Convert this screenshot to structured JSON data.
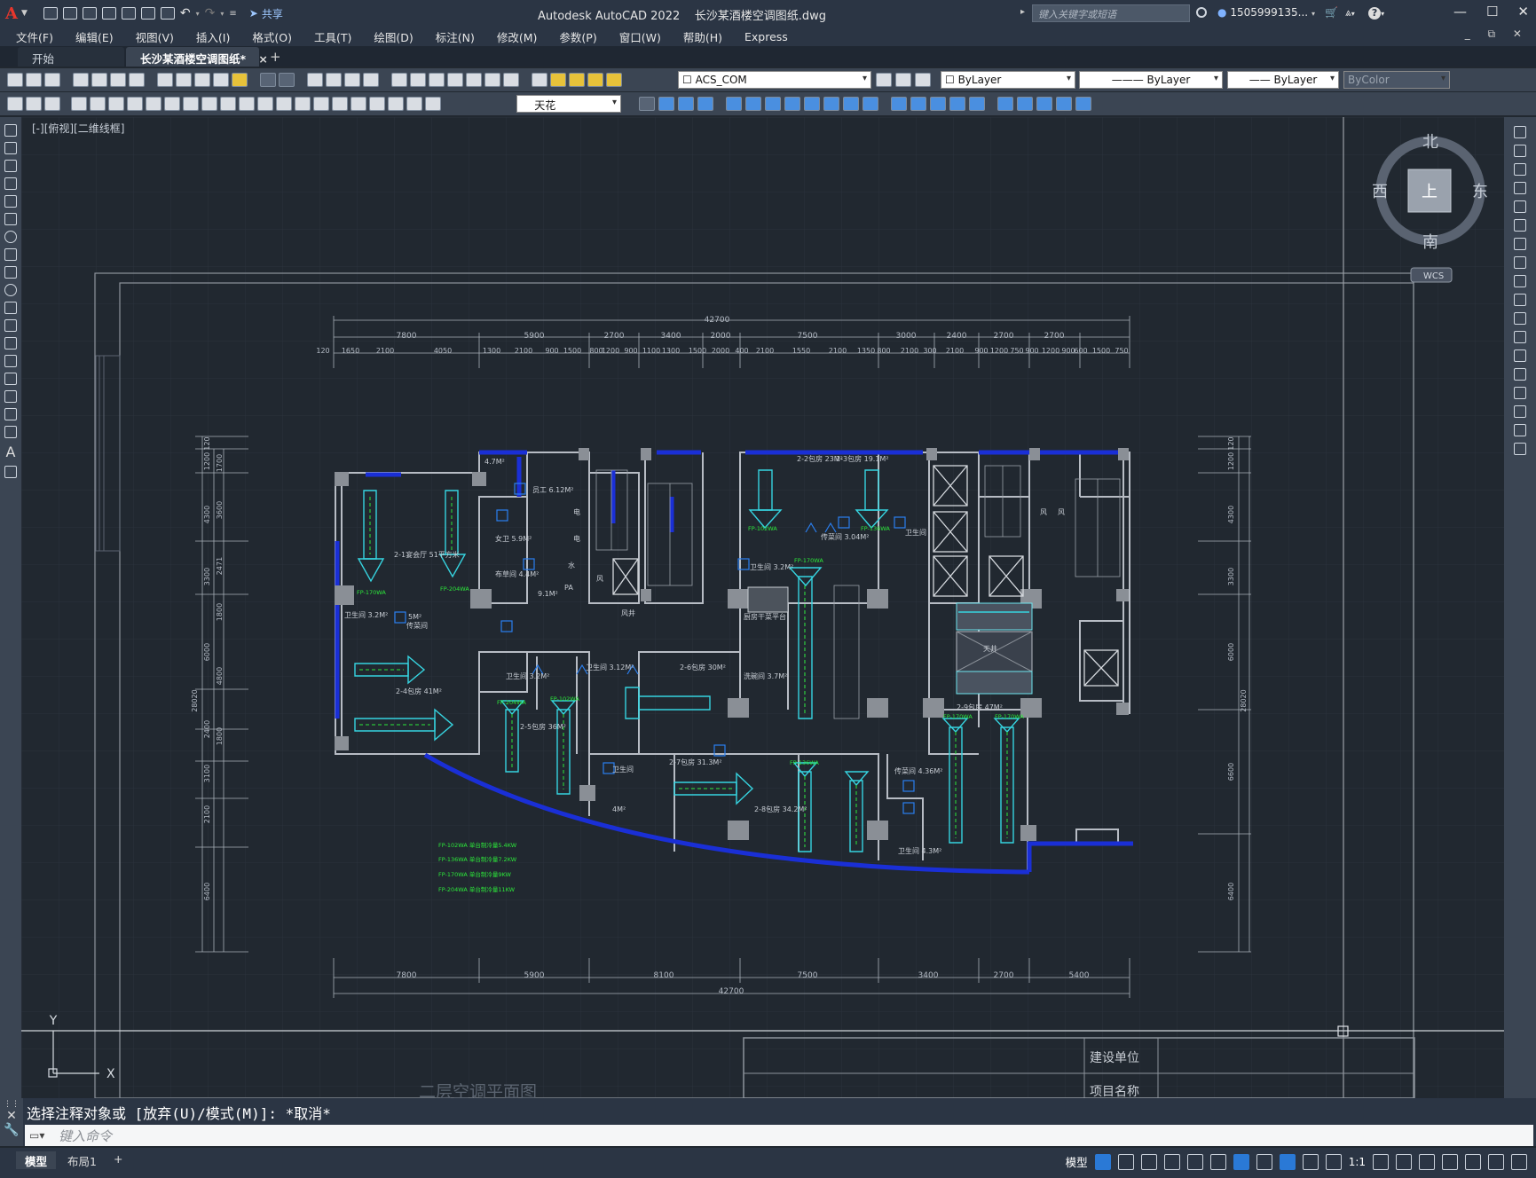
{
  "app": {
    "logo_letter": "A",
    "title": "Autodesk AutoCAD 2022",
    "filename": "长沙某酒楼空调图纸.dwg",
    "share_label": "共享",
    "search_placeholder": "键入关键字或短语",
    "user": "1505999135...",
    "minimize": "—",
    "maximize": "☐",
    "close": "✕"
  },
  "menu": {
    "items": [
      "文件(F)",
      "编辑(E)",
      "视图(V)",
      "插入(I)",
      "格式(O)",
      "工具(T)",
      "绘图(D)",
      "标注(N)",
      "修改(M)",
      "参数(P)",
      "窗口(W)",
      "帮助(H)",
      "Express"
    ]
  },
  "tabs": {
    "start": "开始",
    "active": "长沙某酒楼空调图纸*",
    "close": "×",
    "add": "+"
  },
  "toolbar": {
    "layer_name": "ACS_COM",
    "color": "ByLayer",
    "linetype": "ByLayer",
    "lineweight": "ByLayer",
    "plotstyle": "ByColor",
    "text_style": "天花"
  },
  "viewport": {
    "label": "[-][俯视][二维线框]",
    "compass_n": "北",
    "compass_s": "南",
    "compass_e": "东",
    "compass_w": "西",
    "compass_center": "上",
    "wcs": "WCS",
    "ucs_x": "X",
    "ucs_y": "Y"
  },
  "drawing": {
    "total_dim_top": "42700",
    "total_dim_bottom": "42700",
    "top_dims": [
      "7800",
      "5900",
      "2700",
      "3400",
      "2000",
      "7500",
      "3000",
      "2400",
      "2700",
      "2700"
    ],
    "top_subdims": [
      "120",
      "1650",
      "2100",
      "4050",
      "1300",
      "2100",
      "900",
      "1500",
      "800",
      "1200",
      "900",
      "1100",
      "1300",
      "1500",
      "2000",
      "400",
      "2100",
      "1550",
      "2100",
      "1350",
      "800",
      "2100",
      "300",
      "2100",
      "900",
      "1200",
      "750",
      "900",
      "1200",
      "900",
      "600",
      "1500",
      "750"
    ],
    "bottom_dims": [
      "7800",
      "5900",
      "8100",
      "7500",
      "3400",
      "2700",
      "5400"
    ],
    "left_dims": [
      "120",
      "1200",
      "4300",
      "3300",
      "6000",
      "2400",
      "3100",
      "2100",
      "6400"
    ],
    "left_subdims": [
      "1700",
      "3600",
      "2471",
      "1800",
      "4800",
      "1800",
      "28020"
    ],
    "right_dims": [
      "120",
      "1200",
      "4300",
      "3300",
      "6000",
      "6600",
      "6400"
    ],
    "right_total": "28020",
    "rooms": [
      "2-1宴会厅 51平方米",
      "卫生间 3.2M²",
      "2-4包房 41M²",
      "4.7M²",
      "员工 6.12M²",
      "女卫 5.9M²",
      "布草间 4.4M²",
      "9.1M²",
      "传菜间",
      "5M²",
      "卫生间 3.2M²",
      "2-5包房 36M²",
      "卫生间 3.12M²",
      "2-6包房 30M²",
      "洗碗间 3.7M²",
      "2-2包房 23M²",
      "2-3包房 19.1M²",
      "传菜间 3.04M²",
      "卫生间 3.2M²",
      "厨房干菜平台",
      "卫生间",
      "天井",
      "2-9包房 47M²",
      "2-7包房 31.3M²",
      "卫生间",
      "4M²",
      "2-8包房 34.2M²",
      "传菜间 4.36M²",
      "卫生间 4.3M²",
      "电",
      "电",
      "水",
      "风",
      "风",
      "风",
      "PA",
      "风井"
    ],
    "units": [
      "FP-170WA",
      "FP-204WA",
      "FP-102WA",
      "FP-136WA",
      "FP-170WA",
      "FP-204WA",
      "FP-170WA",
      "FP-170WA",
      "FP-136WA",
      "FP-102WA"
    ],
    "legend": [
      "FP-102WA    单台制冷量5.4KW",
      "FP-136WA    单台制冷量7.2KW",
      "FP-170WA    单台制冷量9KW",
      "FP-204WA    单台制冷量11KW"
    ],
    "plan_title": "二层空调平面图",
    "titleblock_row1": "建设单位",
    "titleblock_row2": "项目名称"
  },
  "command": {
    "history": "选择注释对象或 [放弃(U)/模式(M)]: *取消*",
    "placeholder": "键入命令"
  },
  "status": {
    "layout_model": "模型",
    "layout_1": "布局1",
    "layout_add": "+",
    "model_space": "模型",
    "scale": "1:1"
  },
  "colors": {
    "background": "#212830",
    "wall": "#b7bcc4",
    "duct": "#36d4e0",
    "accent_blue": "#1a2fd6",
    "green": "#2ce83a",
    "dims": "#b5bcc6"
  }
}
